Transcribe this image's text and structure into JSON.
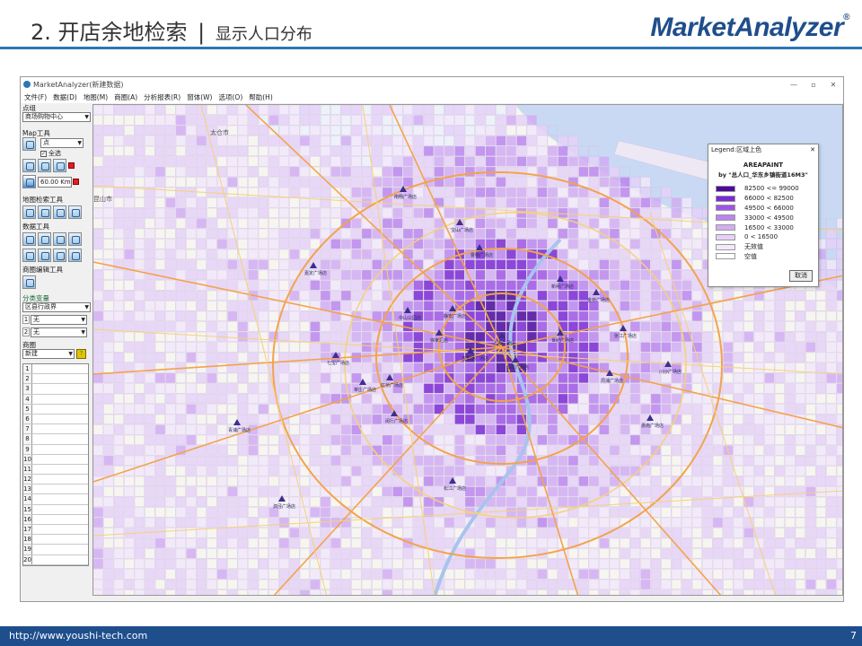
{
  "slide": {
    "title_main": "2. 开店余地检索",
    "title_sep": "|",
    "title_sub": "显示人口分布",
    "logo": "MarketAnalyzer",
    "logo_reg": "®",
    "footer_url": "http://www.youshi-tech.com",
    "page_number": "7"
  },
  "window": {
    "title": "MarketAnalyzer(新建数据)",
    "menu": [
      "文件(F)",
      "数据(D)",
      "地图(M)",
      "商圈(A)",
      "分析报表(R)",
      "窗体(W)",
      "选项(O)",
      "帮助(H)"
    ],
    "minimize": "—",
    "maximize": "▫",
    "close": "✕"
  },
  "panel": {
    "point_group": "点组",
    "point_group_value": "商场购物中心",
    "map_tools": "Map工具",
    "point_type": "点",
    "select_all": "全选",
    "distance_value": "60.00",
    "distance_unit": "Km",
    "map_search_tools": "地图检索工具",
    "data_tools": "数据工具",
    "trade_area_edit_tools": "商圈编辑工具",
    "category_vars": "分类变量",
    "var_1": "区县行政界",
    "var_2_index": "1",
    "var_2": "无",
    "var_3_index": "2",
    "var_3": "无",
    "trade_area": "商圈",
    "trade_area_value": "新建",
    "rows": [
      "1",
      "2",
      "3",
      "4",
      "5",
      "6",
      "7",
      "8",
      "9",
      "10",
      "11",
      "12",
      "13",
      "14",
      "15",
      "16",
      "17",
      "18",
      "19",
      "20"
    ]
  },
  "map": {
    "city_labels": [
      "太仓市",
      "昆山市"
    ],
    "store_labels": [
      "南翔广场店",
      "宝山广场店",
      "曹杨广场店",
      "新闸广场店",
      "静安广场店",
      "中山公园店",
      "徐家汇店",
      "五角场广场店",
      "上海广场店",
      "仙霞广场店",
      "虹桥广场店",
      "七宝广场店",
      "莘庄广场店",
      "闵行广场店",
      "金桥广场店",
      "世纪广场店",
      "张江广场店",
      "周浦广场店",
      "川沙广场店",
      "惠南广场店",
      "松江广场店",
      "泗泾广场店",
      "青浦广场店",
      "嘉定广场店"
    ],
    "colors": {
      "water": "#c9d9f3",
      "land": "#f7f5f0",
      "grid": "#cfc2e6",
      "road_major": "#f3a34a",
      "road_minor": "#f6d178",
      "river": "#a8c4ee",
      "store": "#3c2f8f"
    }
  },
  "legend": {
    "title": "Legend:区域上色",
    "close": "✕",
    "heading": "AREAPAINT",
    "subheading": "by \"总人口_华东乡镇街道16M3\"",
    "items": [
      {
        "label": "82500 <= 99000",
        "color": "#4b0a9e"
      },
      {
        "label": "66000 < 82500",
        "color": "#7a29d6"
      },
      {
        "label": "49500 < 66000",
        "color": "#9d55e6"
      },
      {
        "label": "33000 < 49500",
        "color": "#bb86ef"
      },
      {
        "label": "16500 < 33000",
        "color": "#d2adf4"
      },
      {
        "label": "0 < 16500",
        "color": "#e6d2f8"
      },
      {
        "label": "无效值",
        "color": "#f3e9fb"
      },
      {
        "label": "空值",
        "color": "#ffffff"
      }
    ],
    "cancel": "取消"
  }
}
